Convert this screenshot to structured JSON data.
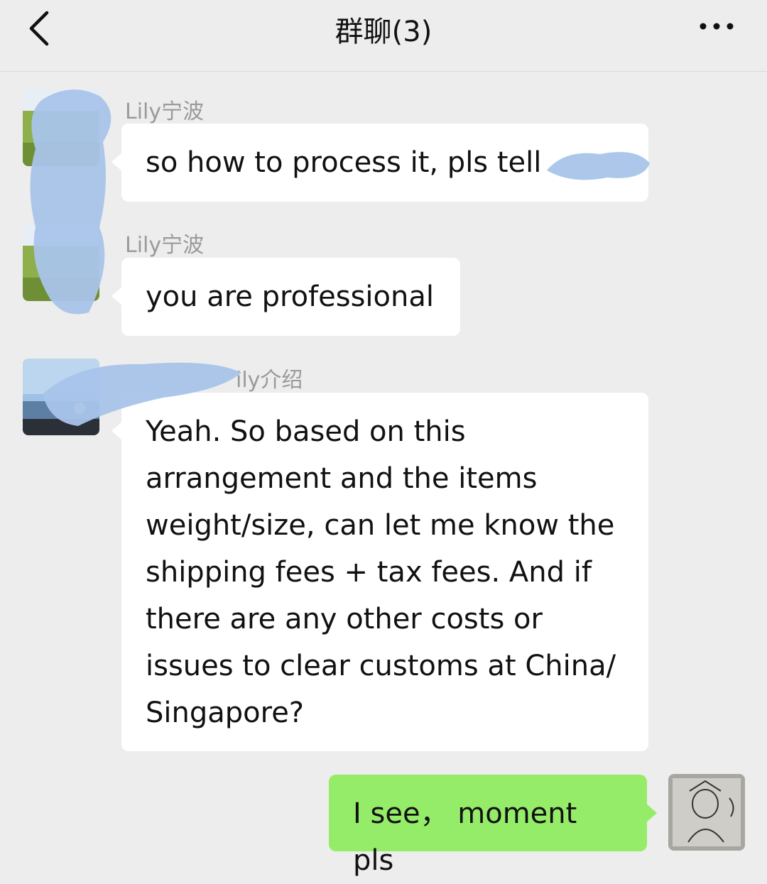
{
  "header": {
    "title": "群聊(3)"
  },
  "messages": [
    {
      "sender": "Lily宁波",
      "text": "so how to process it, pls tell"
    },
    {
      "sender": "Lily宁波",
      "text": "you are professional"
    },
    {
      "sender": "ily介绍",
      "text": "Yeah. So based on this arrangement and the items weight/size, can let me know the shipping fees + tax fees. And if there are any other costs or issues to clear customs at China/ Singapore?"
    },
    {
      "text": "I see， moment pls"
    }
  ],
  "colors": {
    "background": "#ededed",
    "incoming_bubble": "#ffffff",
    "outgoing_bubble": "#95ec69",
    "redaction": "#a9c4ea"
  }
}
